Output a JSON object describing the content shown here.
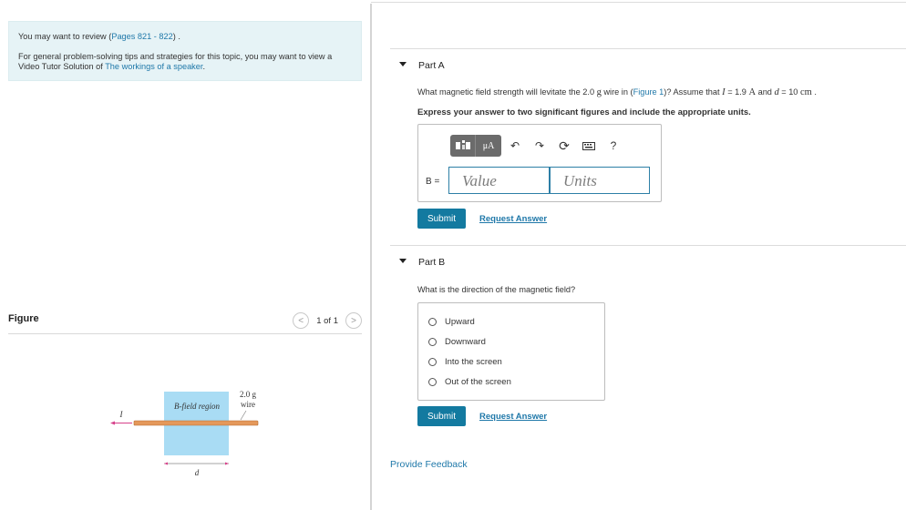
{
  "review": {
    "prefix": "You may want to review (",
    "pages_link": "Pages 821 - 822",
    "suffix": ") .",
    "tutor_text": "For general problem-solving tips and strategies for this topic, you may want to view a Video Tutor Solution of ",
    "tutor_link": "The workings of a speaker",
    "tutor_suffix": "."
  },
  "figure": {
    "title": "Figure",
    "pager": {
      "prev": "<",
      "count": "1 of 1",
      "next": ">"
    },
    "labels": {
      "current": "I",
      "region": "B-field region",
      "mass": "2.0 g",
      "wire": "wire",
      "distance": "d"
    },
    "colors": {
      "region": "#a9dcf4",
      "wire": "#e4985a",
      "arrow": "#d6408a"
    }
  },
  "partA": {
    "title": "Part A",
    "question_pre": "What magnetic field strength will levitate the 2.0 ",
    "unit_g": "g",
    "question_mid": " wire in (",
    "figure_link": "Figure 1",
    "question_mid2": ")? Assume that ",
    "var_I": "I",
    "eq1": " = 1.9 ",
    "unit_A": "A",
    "and": " and ",
    "var_d": "d",
    "eq2": " = 10 ",
    "unit_cm": "cm",
    "end": " .",
    "instructions": "Express your answer to two significant figures and include the appropriate units.",
    "toolbar": {
      "templates": "templates-icon",
      "mu": "μA",
      "undo": "↶",
      "redo": "↷",
      "reset": "⟳",
      "keyboard": "keyboard-icon",
      "help": "?"
    },
    "variable_label": "B =",
    "value_placeholder": "Value",
    "units_placeholder": "Units",
    "submit": "Submit",
    "request": "Request Answer"
  },
  "partB": {
    "title": "Part B",
    "question": "What is the direction of the magnetic field?",
    "choices": [
      "Upward",
      "Downward",
      "Into the screen",
      "Out of the screen"
    ],
    "submit": "Submit",
    "request": "Request Answer"
  },
  "feedback": "Provide Feedback"
}
